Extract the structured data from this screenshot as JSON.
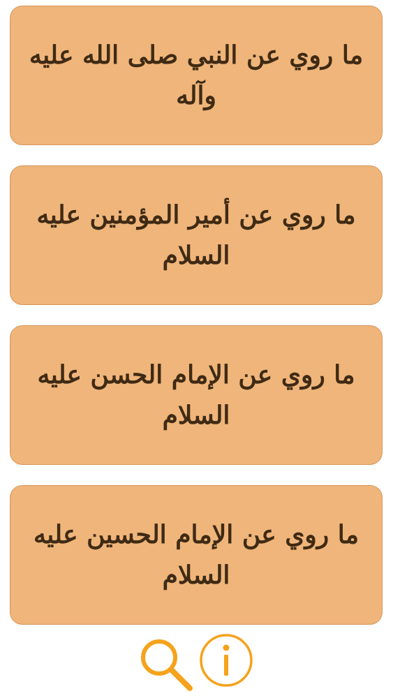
{
  "menu": {
    "items": [
      {
        "label": "ما روي عن النبي صلى الله عليه وآله"
      },
      {
        "label": "ما روي عن أمير المؤمنين عليه السلام"
      },
      {
        "label": "ما روي عن الإمام الحسن عليه السلام"
      },
      {
        "label": "ما روي عن الإمام الحسين عليه السلام"
      }
    ]
  },
  "bottom_bar": {
    "search_icon": "search-icon",
    "info_icon": "info-icon"
  },
  "colors": {
    "card_background": "#efb57a",
    "card_border": "#d8955a",
    "card_text": "#3f2a14",
    "icon_accent": "#f5a21c"
  }
}
